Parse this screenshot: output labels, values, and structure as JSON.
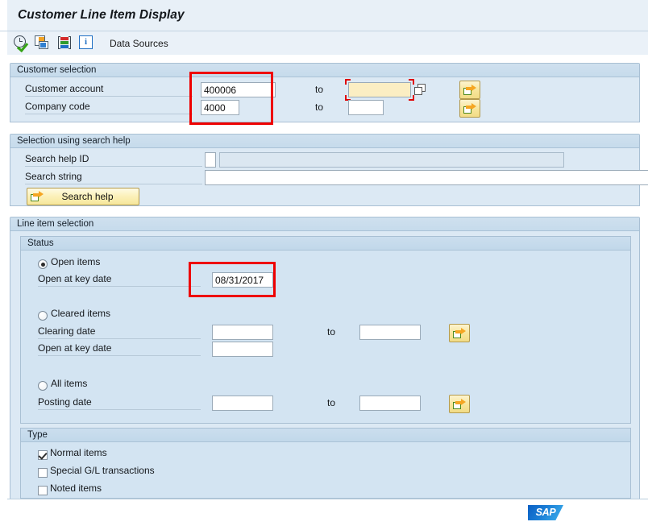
{
  "window": {
    "title": "Customer Line Item Display"
  },
  "toolbar": {
    "icons": [
      {
        "name": "execute-icon",
        "title": "Execute"
      },
      {
        "name": "multiple-windows-icon",
        "title": "Overview"
      },
      {
        "name": "variant-icon",
        "title": "Get Variant"
      },
      {
        "name": "info-icon",
        "title": "Information",
        "glyph": "i"
      }
    ],
    "data_sources_label": "Data Sources"
  },
  "customer_selection": {
    "header": "Customer selection",
    "rows": [
      {
        "label": "Customer account",
        "value": "400006",
        "to_label": "to",
        "to_value": "",
        "to_placeholder": "",
        "multi_button_label": ""
      },
      {
        "label": "Company code",
        "value": "4000",
        "to_label": "to",
        "to_value": "",
        "to_placeholder": "",
        "multi_button_label": ""
      }
    ]
  },
  "search_help_section": {
    "header": "Selection using search help",
    "search_help_id_label": "Search help ID",
    "search_help_id_value": "",
    "search_help_id_desc_value": "",
    "search_string_label": "Search string",
    "search_string_value": "",
    "search_help_button_label": "Search help"
  },
  "line_item_selection": {
    "header": "Line item selection",
    "status": {
      "header": "Status",
      "open_items": {
        "label": "Open items",
        "selected": true,
        "key_date_label": "Open at key date",
        "key_date_value": "08/31/2017"
      },
      "cleared_items": {
        "label": "Cleared items",
        "selected": false,
        "clearing_date_label": "Clearing date",
        "clearing_date_from": "",
        "clearing_date_to_label": "to",
        "clearing_date_to": "",
        "key_date_label": "Open at key date",
        "key_date_value": ""
      },
      "all_items": {
        "label": "All items",
        "selected": false,
        "posting_date_label": "Posting date",
        "posting_date_from": "",
        "posting_date_to_label": "to",
        "posting_date_to": ""
      }
    },
    "type": {
      "header": "Type",
      "options": [
        {
          "label": "Normal items",
          "checked": true
        },
        {
          "label": "Special G/L transactions",
          "checked": false
        },
        {
          "label": "Noted items",
          "checked": false
        }
      ]
    }
  },
  "footer": {
    "logo_text": "SAP"
  },
  "colors": {
    "accent": "#1f6fc4",
    "group_bg": "#dce9f4",
    "annotation": "#ee0000",
    "focus_field": "#fbeec3",
    "button_yellow": "#f7e59a"
  }
}
